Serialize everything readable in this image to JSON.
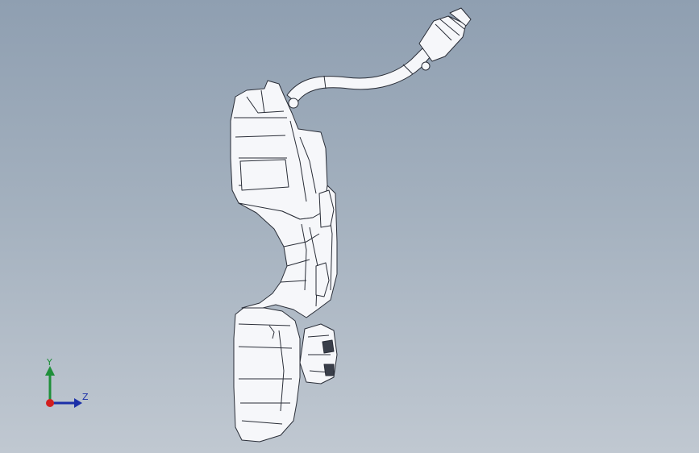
{
  "viewport": {
    "background_top": "#8f9fb1",
    "background_bottom": "#c0c8d1",
    "model_fill": "#f6f7fa",
    "model_line": "#2a2e38"
  },
  "triad": {
    "y_label": "Y",
    "z_label": "Z",
    "y_color": "#1f8f3a",
    "z_color": "#1b2fa8",
    "x_color": "#d21f1f"
  }
}
